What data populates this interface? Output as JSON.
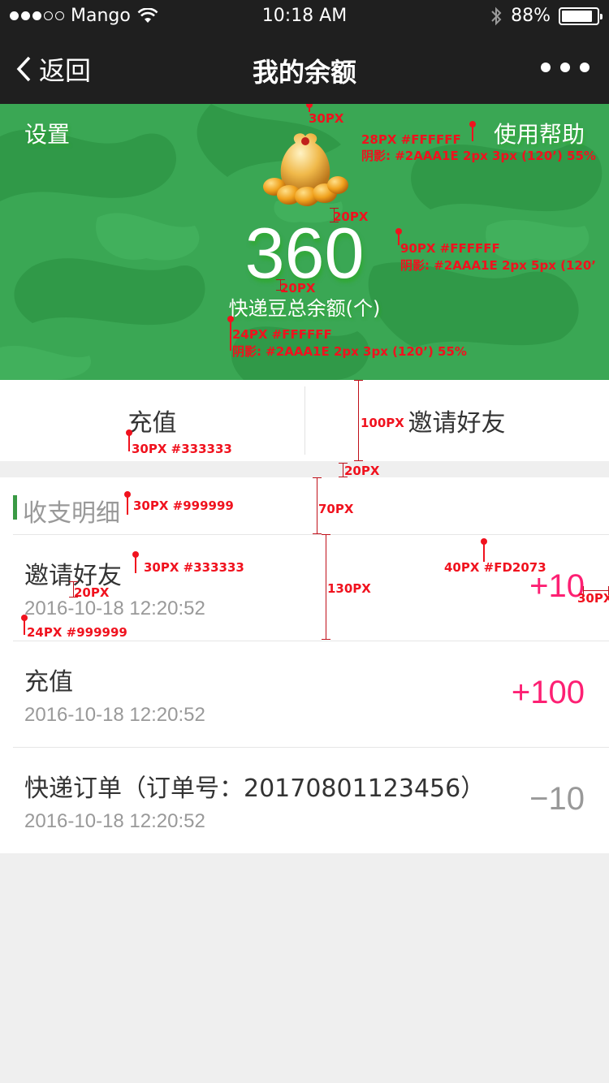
{
  "status_bar": {
    "carrier": "Mango",
    "time": "10:18 AM",
    "battery": "88%",
    "battery_level": 0.88,
    "signal_bars": 3
  },
  "nav": {
    "back_label": "返回",
    "title": "我的余额"
  },
  "hero": {
    "settings_label": "设置",
    "help_label": "使用帮助",
    "amount": "360",
    "amount_label": "快递豆总余额(个)",
    "colors": {
      "background": "#3aa754",
      "text": "#FFFFFF",
      "shadow": "#2AAA1E"
    }
  },
  "annotations": {
    "top_gap": "30PX",
    "help_spec": "28PX #FFFFFF",
    "help_shadow": "阴影: #2AAA1E 2px 3px (120’) 55%",
    "bag_gap": "20PX",
    "amount_spec": "90PX #FFFFFF",
    "amount_shadow": "阴影: #2AAA1E 2px 5px (120’",
    "label_gap": "20PX",
    "label_spec": "24PX #FFFFFF",
    "label_shadow": "阴影: #2AAA1E 2px 3px (120’) 55%",
    "action_height": "100PX",
    "action_spec": "30PX #333333",
    "section_gap": "20PX",
    "header_spec": "30PX #999999",
    "header_height": "70PX",
    "row_name_spec": "30PX #333333",
    "row_value_spec": "40PX #FD2073",
    "row_height": "130PX",
    "row_inner_gap": "20PX",
    "row_date_spec": "24PX #999999",
    "right_margin": "30PX"
  },
  "actions": {
    "recharge_label": "充值",
    "invite_label": "邀请好友"
  },
  "list": {
    "title": "收支明细",
    "accent": "#3a9a44",
    "rows": [
      {
        "name": "邀请好友",
        "date": "2016-10-18  12:20:52",
        "value": "+10",
        "kind": "plus"
      },
      {
        "name": "充值",
        "date": "2016-10-18  12:20:52",
        "value": "+100",
        "kind": "plus"
      },
      {
        "name": "快递订单（订单号：20170801123456）",
        "date": "2016-10-18  12:20:52",
        "value": "−10",
        "kind": "minus"
      }
    ]
  }
}
